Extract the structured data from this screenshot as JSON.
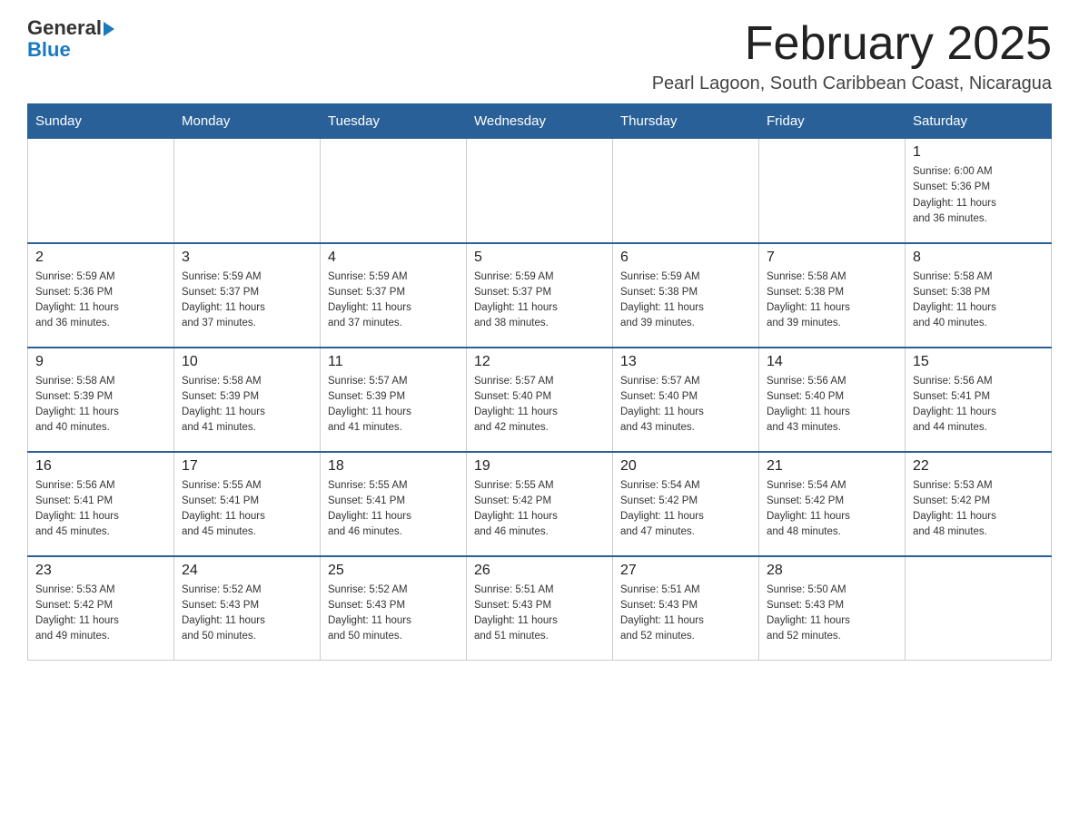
{
  "header": {
    "logo_general": "General",
    "logo_blue": "Blue",
    "month_title": "February 2025",
    "location": "Pearl Lagoon, South Caribbean Coast, Nicaragua"
  },
  "days_of_week": [
    "Sunday",
    "Monday",
    "Tuesday",
    "Wednesday",
    "Thursday",
    "Friday",
    "Saturday"
  ],
  "weeks": [
    {
      "days": [
        {
          "num": "",
          "info": ""
        },
        {
          "num": "",
          "info": ""
        },
        {
          "num": "",
          "info": ""
        },
        {
          "num": "",
          "info": ""
        },
        {
          "num": "",
          "info": ""
        },
        {
          "num": "",
          "info": ""
        },
        {
          "num": "1",
          "info": "Sunrise: 6:00 AM\nSunset: 5:36 PM\nDaylight: 11 hours\nand 36 minutes."
        }
      ]
    },
    {
      "days": [
        {
          "num": "2",
          "info": "Sunrise: 5:59 AM\nSunset: 5:36 PM\nDaylight: 11 hours\nand 36 minutes."
        },
        {
          "num": "3",
          "info": "Sunrise: 5:59 AM\nSunset: 5:37 PM\nDaylight: 11 hours\nand 37 minutes."
        },
        {
          "num": "4",
          "info": "Sunrise: 5:59 AM\nSunset: 5:37 PM\nDaylight: 11 hours\nand 37 minutes."
        },
        {
          "num": "5",
          "info": "Sunrise: 5:59 AM\nSunset: 5:37 PM\nDaylight: 11 hours\nand 38 minutes."
        },
        {
          "num": "6",
          "info": "Sunrise: 5:59 AM\nSunset: 5:38 PM\nDaylight: 11 hours\nand 39 minutes."
        },
        {
          "num": "7",
          "info": "Sunrise: 5:58 AM\nSunset: 5:38 PM\nDaylight: 11 hours\nand 39 minutes."
        },
        {
          "num": "8",
          "info": "Sunrise: 5:58 AM\nSunset: 5:38 PM\nDaylight: 11 hours\nand 40 minutes."
        }
      ]
    },
    {
      "days": [
        {
          "num": "9",
          "info": "Sunrise: 5:58 AM\nSunset: 5:39 PM\nDaylight: 11 hours\nand 40 minutes."
        },
        {
          "num": "10",
          "info": "Sunrise: 5:58 AM\nSunset: 5:39 PM\nDaylight: 11 hours\nand 41 minutes."
        },
        {
          "num": "11",
          "info": "Sunrise: 5:57 AM\nSunset: 5:39 PM\nDaylight: 11 hours\nand 41 minutes."
        },
        {
          "num": "12",
          "info": "Sunrise: 5:57 AM\nSunset: 5:40 PM\nDaylight: 11 hours\nand 42 minutes."
        },
        {
          "num": "13",
          "info": "Sunrise: 5:57 AM\nSunset: 5:40 PM\nDaylight: 11 hours\nand 43 minutes."
        },
        {
          "num": "14",
          "info": "Sunrise: 5:56 AM\nSunset: 5:40 PM\nDaylight: 11 hours\nand 43 minutes."
        },
        {
          "num": "15",
          "info": "Sunrise: 5:56 AM\nSunset: 5:41 PM\nDaylight: 11 hours\nand 44 minutes."
        }
      ]
    },
    {
      "days": [
        {
          "num": "16",
          "info": "Sunrise: 5:56 AM\nSunset: 5:41 PM\nDaylight: 11 hours\nand 45 minutes."
        },
        {
          "num": "17",
          "info": "Sunrise: 5:55 AM\nSunset: 5:41 PM\nDaylight: 11 hours\nand 45 minutes."
        },
        {
          "num": "18",
          "info": "Sunrise: 5:55 AM\nSunset: 5:41 PM\nDaylight: 11 hours\nand 46 minutes."
        },
        {
          "num": "19",
          "info": "Sunrise: 5:55 AM\nSunset: 5:42 PM\nDaylight: 11 hours\nand 46 minutes."
        },
        {
          "num": "20",
          "info": "Sunrise: 5:54 AM\nSunset: 5:42 PM\nDaylight: 11 hours\nand 47 minutes."
        },
        {
          "num": "21",
          "info": "Sunrise: 5:54 AM\nSunset: 5:42 PM\nDaylight: 11 hours\nand 48 minutes."
        },
        {
          "num": "22",
          "info": "Sunrise: 5:53 AM\nSunset: 5:42 PM\nDaylight: 11 hours\nand 48 minutes."
        }
      ]
    },
    {
      "days": [
        {
          "num": "23",
          "info": "Sunrise: 5:53 AM\nSunset: 5:42 PM\nDaylight: 11 hours\nand 49 minutes."
        },
        {
          "num": "24",
          "info": "Sunrise: 5:52 AM\nSunset: 5:43 PM\nDaylight: 11 hours\nand 50 minutes."
        },
        {
          "num": "25",
          "info": "Sunrise: 5:52 AM\nSunset: 5:43 PM\nDaylight: 11 hours\nand 50 minutes."
        },
        {
          "num": "26",
          "info": "Sunrise: 5:51 AM\nSunset: 5:43 PM\nDaylight: 11 hours\nand 51 minutes."
        },
        {
          "num": "27",
          "info": "Sunrise: 5:51 AM\nSunset: 5:43 PM\nDaylight: 11 hours\nand 52 minutes."
        },
        {
          "num": "28",
          "info": "Sunrise: 5:50 AM\nSunset: 5:43 PM\nDaylight: 11 hours\nand 52 minutes."
        },
        {
          "num": "",
          "info": ""
        }
      ]
    }
  ]
}
